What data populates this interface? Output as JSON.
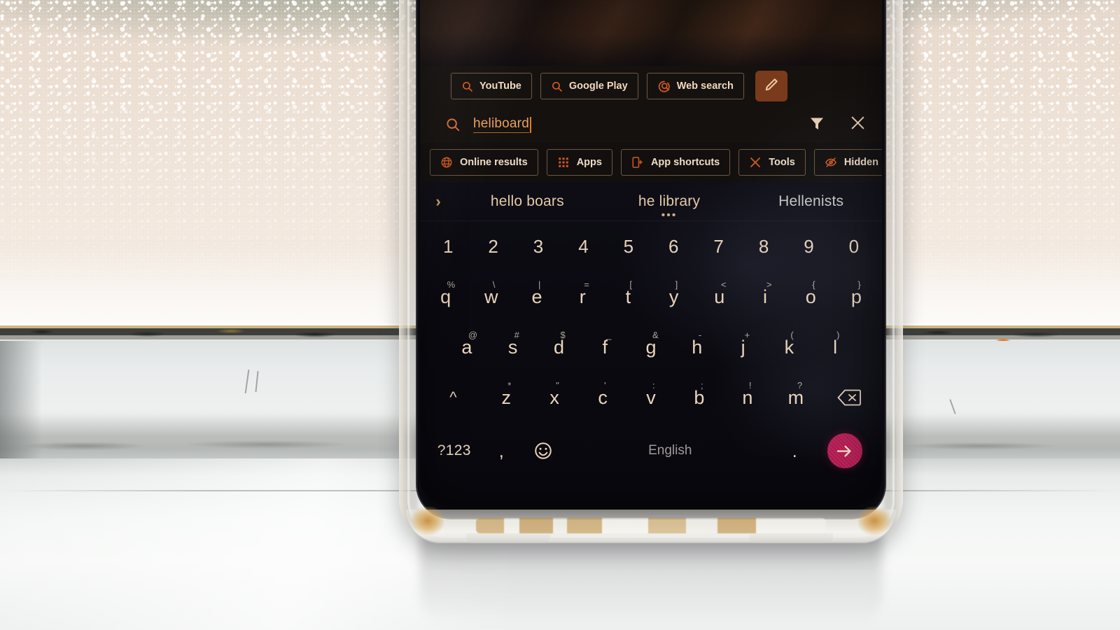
{
  "scene": {
    "description": "smartphone in clear case on a windowsill showing a launcher search overlay with on-screen keyboard"
  },
  "search": {
    "query": "heliboard",
    "search_icon": "search-icon",
    "targets": [
      {
        "label": "YouTube",
        "icon": "search-icon"
      },
      {
        "label": "Google Play",
        "icon": "search-icon"
      },
      {
        "label": "Web search",
        "icon": "web-search-icon"
      }
    ],
    "edit_icon": "pencil-icon",
    "filter_icon": "funnel-icon",
    "clear_icon": "close-icon"
  },
  "filters": [
    {
      "label": "Online results",
      "icon": "globe-icon"
    },
    {
      "label": "Apps",
      "icon": "grid-icon"
    },
    {
      "label": "App shortcuts",
      "icon": "app-shortcut-icon"
    },
    {
      "label": "Tools",
      "icon": "tools-icon"
    },
    {
      "label": "Hidden",
      "icon": "eye-off-icon"
    }
  ],
  "keyboard": {
    "expand_icon": "chevron-right-icon",
    "suggestions": [
      {
        "text": "hello boars",
        "more": ""
      },
      {
        "text": "he library",
        "more": "•••"
      },
      {
        "text": "Hellenists",
        "more": ""
      }
    ],
    "number_row": [
      "1",
      "2",
      "3",
      "4",
      "5",
      "6",
      "7",
      "8",
      "9",
      "0"
    ],
    "row1": [
      {
        "key": "q",
        "hint": "%"
      },
      {
        "key": "w",
        "hint": "\\"
      },
      {
        "key": "e",
        "hint": "|"
      },
      {
        "key": "r",
        "hint": "="
      },
      {
        "key": "t",
        "hint": "["
      },
      {
        "key": "y",
        "hint": "]"
      },
      {
        "key": "u",
        "hint": "<"
      },
      {
        "key": "i",
        "hint": ">"
      },
      {
        "key": "o",
        "hint": "{"
      },
      {
        "key": "p",
        "hint": "}"
      }
    ],
    "row2": [
      {
        "key": "a",
        "hint": "@"
      },
      {
        "key": "s",
        "hint": "#"
      },
      {
        "key": "d",
        "hint": "$"
      },
      {
        "key": "f",
        "hint": "_"
      },
      {
        "key": "g",
        "hint": "&"
      },
      {
        "key": "h",
        "hint": "-"
      },
      {
        "key": "j",
        "hint": "+"
      },
      {
        "key": "k",
        "hint": "("
      },
      {
        "key": "l",
        "hint": ")"
      }
    ],
    "row3": [
      {
        "key": "z",
        "hint": "*"
      },
      {
        "key": "x",
        "hint": "\""
      },
      {
        "key": "c",
        "hint": "'"
      },
      {
        "key": "v",
        "hint": ":"
      },
      {
        "key": "b",
        "hint": ";"
      },
      {
        "key": "n",
        "hint": "!"
      },
      {
        "key": "m",
        "hint": "?"
      }
    ],
    "shift_label": "^",
    "backspace_icon": "backspace-icon",
    "symbols_label": "?123",
    "comma_label": ",",
    "emoji_icon": "emoji-icon",
    "space_label": "English",
    "period_label": ".",
    "enter_icon": "arrow-right-icon"
  },
  "colors": {
    "accent_orange": "#cf5a22",
    "text_cream": "#f0dcc6",
    "query_orange": "#e9a05e",
    "enter_pink": "#b0184f",
    "edit_button_brown": "#7a3a1c",
    "screen_black": "#0a0910",
    "chip_border": "#6d5841"
  }
}
